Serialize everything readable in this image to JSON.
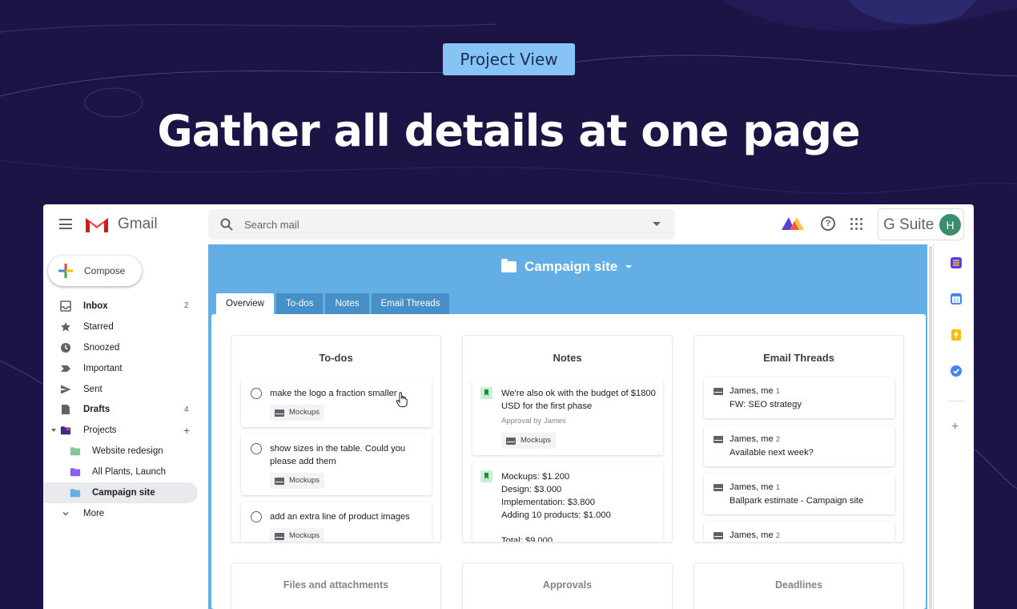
{
  "hero": {
    "badge": "Project View",
    "title": "Gather all details at one page"
  },
  "gmail": {
    "app_name": "Gmail",
    "search_placeholder": "Search mail",
    "gsuite_label": "G Suite",
    "avatar_initial": "H",
    "compose_label": "Compose",
    "nav": [
      {
        "label": "Inbox",
        "count": "2",
        "icon": "inbox-icon"
      },
      {
        "label": "Starred",
        "count": "",
        "icon": "star-icon"
      },
      {
        "label": "Snoozed",
        "count": "",
        "icon": "clock-icon"
      },
      {
        "label": "Important",
        "count": "",
        "icon": "important-icon"
      },
      {
        "label": "Sent",
        "count": "",
        "icon": "send-icon"
      },
      {
        "label": "Drafts",
        "count": "4",
        "icon": "draft-icon"
      },
      {
        "label": "Projects",
        "count": "",
        "icon": "projects-folder-icon"
      },
      {
        "label": "Website redesign",
        "color": "#81c995"
      },
      {
        "label": "All Plants, Launch",
        "color": "#8b5cf6"
      },
      {
        "label": "Campaign site",
        "color": "#64aee6"
      },
      {
        "label": "More",
        "icon": "chevron-down-icon"
      }
    ]
  },
  "project": {
    "title": "Campaign site",
    "tabs": [
      "Overview",
      "To-dos",
      "Notes",
      "Email Threads"
    ],
    "todos": {
      "title": "To-dos",
      "items": [
        {
          "text": "make the logo a fraction smaller",
          "tag": "Mockups"
        },
        {
          "text": "show sizes in the table. Could you please add them",
          "tag": "Mockups"
        },
        {
          "text": "add an extra line of product images",
          "tag": "Mockups"
        }
      ]
    },
    "notes": {
      "title": "Notes",
      "items": [
        {
          "text": "We're also ok with the budget of $1800 USD for the first phase",
          "meta": "Approval by James",
          "tag": "Mockups"
        },
        {
          "lines": [
            "Mockups: $1.200",
            "Design: $3.000",
            "Implementation: $3.800",
            "Adding 10 products: $1.000",
            "",
            "Total: $9.000"
          ]
        }
      ]
    },
    "threads": {
      "title": "Email Threads",
      "items": [
        {
          "from": "James, me",
          "count": "1",
          "subject": "FW: SEO strategy"
        },
        {
          "from": "James, me",
          "count": "2",
          "subject": "Available next week?"
        },
        {
          "from": "James, me",
          "count": "1",
          "subject": "Ballpark estimate - Campaign site"
        },
        {
          "from": "James, me",
          "count": "2",
          "subject": ""
        }
      ]
    },
    "bottom_cards": [
      "Files and attachments",
      "Approvals",
      "Deadlines"
    ]
  },
  "colors": {
    "background": "#1d1446",
    "badge": "#86c4f5",
    "panel": "#64aee6",
    "tab_inactive": "#468fc7",
    "gmail_red": "#ea4335"
  }
}
